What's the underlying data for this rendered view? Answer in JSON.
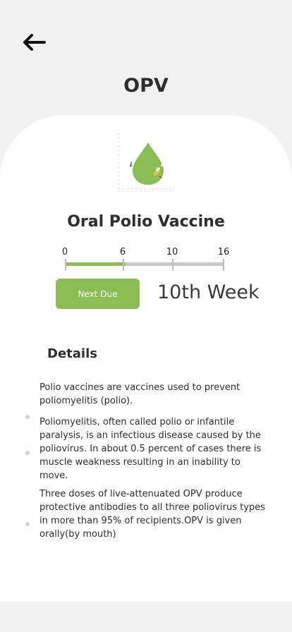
{
  "header": {
    "title": "OPV"
  },
  "vaccine": {
    "name": "Oral Polio Vaccine"
  },
  "schedule": {
    "ticks": [
      "0",
      "6",
      "10",
      "16"
    ],
    "tick_values": [
      0,
      6,
      10,
      16
    ],
    "progress_week": 6,
    "max_week": 16,
    "next_due_label": "Next Due",
    "due_week": "10th Week"
  },
  "details": {
    "heading": "Details",
    "items": [
      "Polio vaccines are vaccines used to prevent poliomyelitis (polio).",
      "Poliomyelitis, often called polio or infantile paralysis, is an infectious disease caused by the poliovirus. In about 0.5 percent of cases there is muscle weakness resulting in an inability  to move.",
      "Three doses of live-attenuated OPV produce protective antibodies to all three poliovirus types in more than 95% of recipients.OPV is given orally(by mouth)"
    ]
  },
  "colors": {
    "accent": "#8bbd55",
    "background": "#f2f2f3",
    "card": "#ffffff",
    "track": "#c8c8c8"
  }
}
